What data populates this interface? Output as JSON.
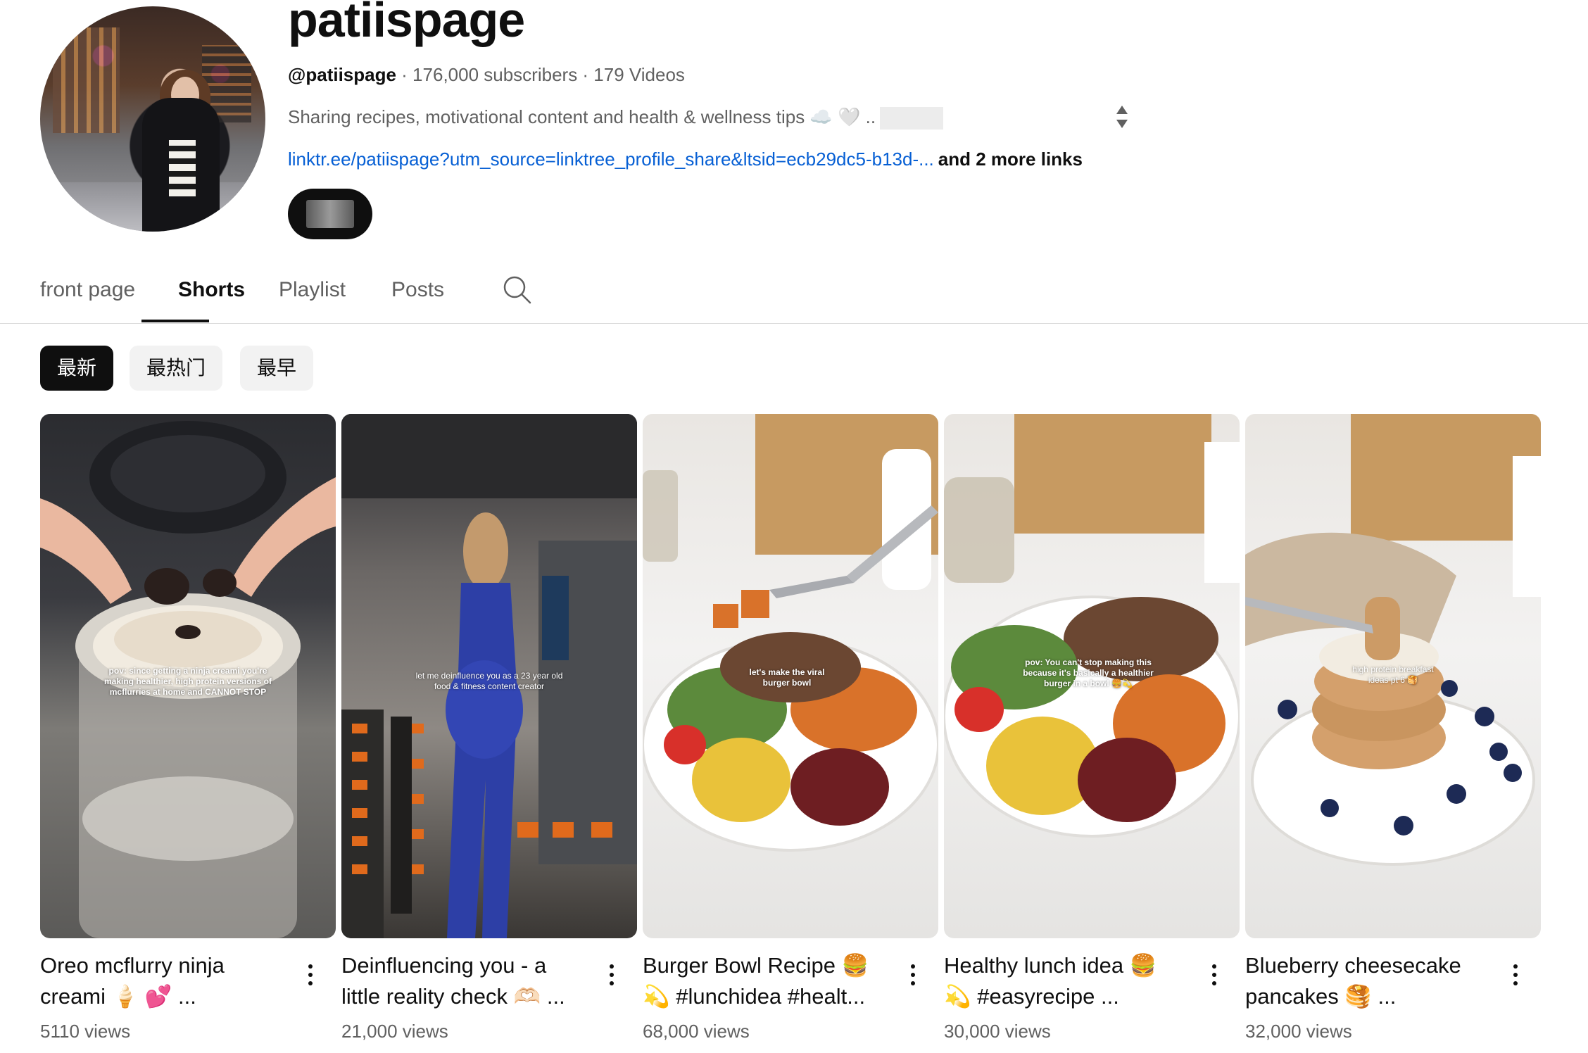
{
  "channel": {
    "name": "patiispage",
    "handle": "@patiispage",
    "meta_rest": " · 176,000 subscribers · 179 Videos",
    "description": "Sharing recipes, motivational content and health & wellness tips ☁️ 🤍 ..",
    "link": "linktr.ee/patiispage?utm_source=linktree_profile_share&ltsid=ecb29dc5-b13d-...",
    "more_links": "and 2 more links"
  },
  "tabs": [
    "front page",
    "Shorts",
    "Playlist",
    "Posts"
  ],
  "active_tab": "Shorts",
  "chips": [
    "最新",
    "最热门",
    "最早"
  ],
  "active_chip": "最新",
  "shorts": [
    {
      "title_line1": "Oreo mcflurry ninja",
      "title_line2": "creami 🍦 💕 ...",
      "views": "5110 views",
      "overlay": "pov: since getting a ninja creami you're making healthier, high protein versions of mcflurries at home and CANNOT STOP"
    },
    {
      "title_line1": "Deinfluencing you - a",
      "title_line2": "little reality check 🫶🏻 ...",
      "views": "21,000 views",
      "overlay": "let me deinfluence you as a 23 year old food & fitness content creator"
    },
    {
      "title_line1": "Burger Bowl Recipe 🍔",
      "title_line2": "💫 #lunchidea #healt...",
      "views": "68,000 views",
      "overlay": "let's make the viral burger bowl"
    },
    {
      "title_line1": "Healthy lunch idea 🍔",
      "title_line2": "💫 #easyrecipe ...",
      "views": "30,000 views",
      "overlay": "pov: You can't stop making this because it's basically a healthier burger in a bowl 🍔💫"
    },
    {
      "title_line1": "Blueberry cheesecake",
      "title_line2": "pancakes 🥞 ...",
      "views": "32,000 views",
      "overlay": "high protein breakfast ideas pt 6 🥞"
    }
  ]
}
